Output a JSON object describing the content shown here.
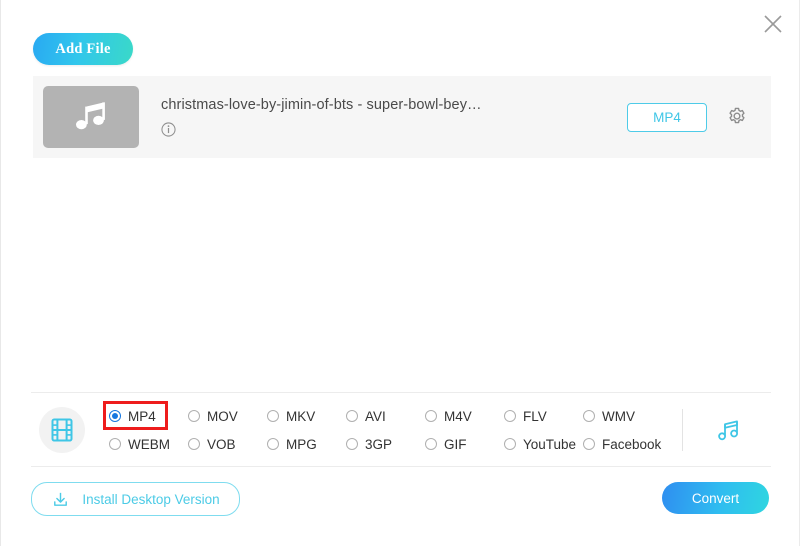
{
  "window": {
    "close_label": "✕"
  },
  "toolbar": {
    "add_file_label": "Add File"
  },
  "file_list": {
    "items": [
      {
        "name": "christmas-love-by-jimin-of-bts - super-bowl-bey…",
        "thumb_icon": "music-note-icon",
        "info_icon": "info-icon",
        "output_format": "MP4",
        "settings_icon": "gear-icon"
      }
    ]
  },
  "format_bar": {
    "video_icon": "film-strip-icon",
    "audio_icon": "music-note-icon",
    "selected": "MP4",
    "options": [
      {
        "label": "MP4",
        "checked": true
      },
      {
        "label": "MOV",
        "checked": false
      },
      {
        "label": "MKV",
        "checked": false
      },
      {
        "label": "AVI",
        "checked": false
      },
      {
        "label": "M4V",
        "checked": false
      },
      {
        "label": "FLV",
        "checked": false
      },
      {
        "label": "WMV",
        "checked": false
      },
      {
        "label": "WEBM",
        "checked": false
      },
      {
        "label": "VOB",
        "checked": false
      },
      {
        "label": "MPG",
        "checked": false
      },
      {
        "label": "3GP",
        "checked": false
      },
      {
        "label": "GIF",
        "checked": false
      },
      {
        "label": "YouTube",
        "checked": false
      },
      {
        "label": "Facebook",
        "checked": false
      }
    ]
  },
  "footer": {
    "install_label": "Install Desktop Version",
    "install_icon": "download-icon",
    "convert_label": "Convert"
  },
  "annotation": {
    "highlight_target": "MP4",
    "highlight_color": "#ee1c1c"
  },
  "colors": {
    "accent_cyan": "#3fc6e6",
    "accent_blue": "#1677e0",
    "panel_gray": "#f6f6f6",
    "thumb_gray": "#b3b3b3"
  }
}
